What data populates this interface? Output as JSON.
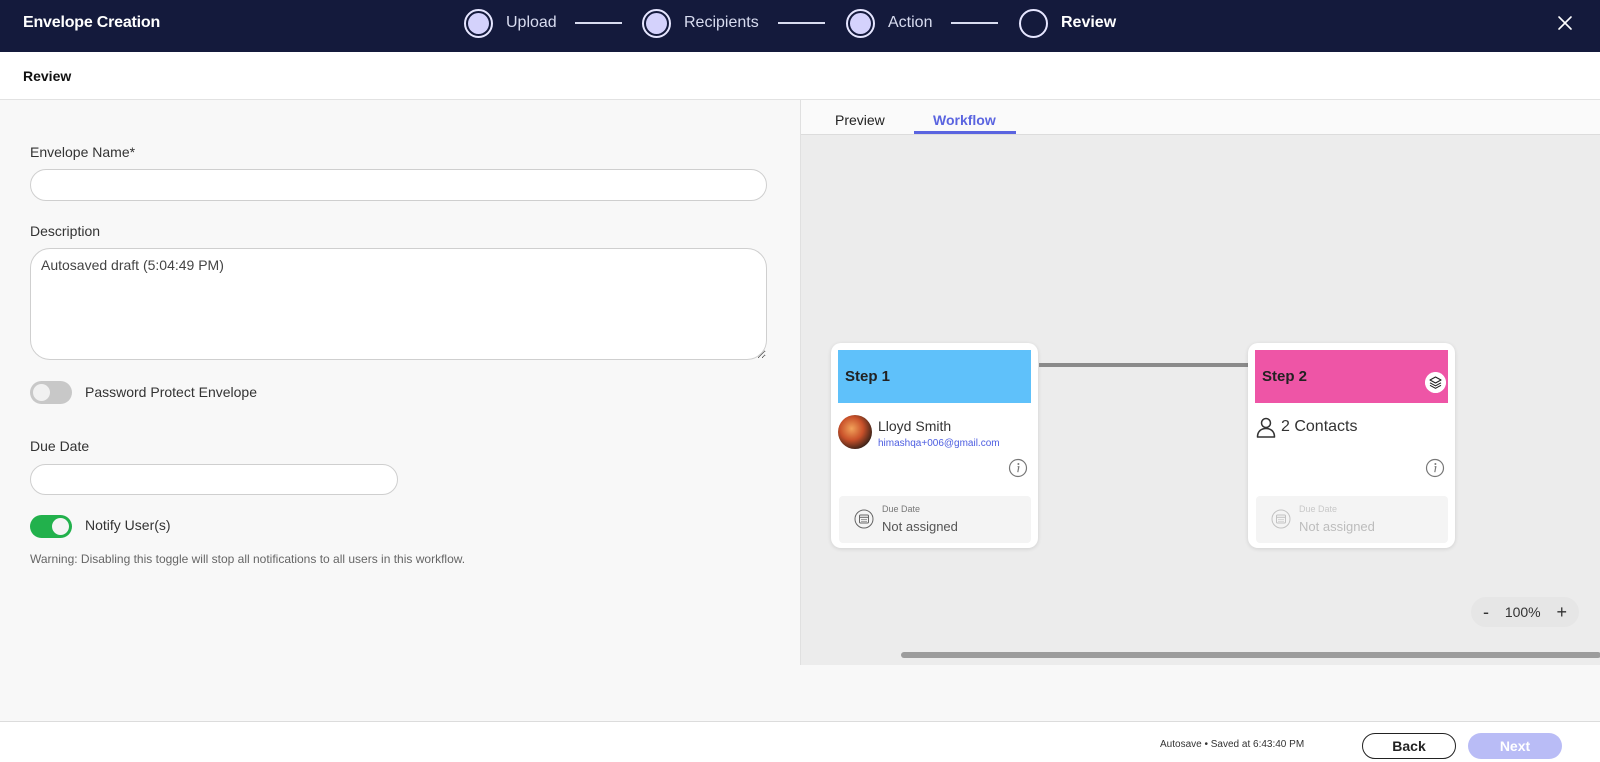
{
  "app": {
    "title": "Envelope Creation"
  },
  "stepper": {
    "steps": [
      {
        "label": "Upload",
        "state": "done"
      },
      {
        "label": "Recipients",
        "state": "done"
      },
      {
        "label": "Action",
        "state": "done"
      },
      {
        "label": "Review",
        "state": "current"
      }
    ]
  },
  "page": {
    "title": "Review"
  },
  "form": {
    "envelope_name_label": "Envelope Name*",
    "envelope_name_value": "",
    "description_label": "Description",
    "description_value": "Autosaved draft (5:04:49 PM)",
    "password_toggle_label": "Password Protect Envelope",
    "password_toggle_on": false,
    "due_date_label": "Due Date",
    "due_date_value": "",
    "notify_toggle_label": "Notify User(s)",
    "notify_toggle_on": true,
    "warning": "Warning: Disabling this toggle will stop all notifications to all users in this workflow."
  },
  "tabs": [
    {
      "label": "Preview",
      "active": false
    },
    {
      "label": "Workflow",
      "active": true
    }
  ],
  "workflow": {
    "steps": [
      {
        "title": "Step 1",
        "color": "#5fc1fa",
        "recipient_name": "Lloyd Smith",
        "recipient_email": "himashqa+006@gmail.com",
        "due_label": "Due Date",
        "due_value": "Not assigned"
      },
      {
        "title": "Step 2",
        "color": "#ee55a6",
        "contacts": "2 Contacts",
        "due_label": "Due Date",
        "due_value": "Not assigned"
      }
    ],
    "zoom": {
      "minus": "-",
      "value": "100%",
      "plus": "+"
    }
  },
  "footer": {
    "autosave": "Autosave • Saved at 6:43:40 PM",
    "back_label": "Back",
    "next_label": "Next"
  },
  "colors": {
    "topbar": "#141a3c",
    "accent": "#5a64e0",
    "toggle_on": "#22b14c",
    "next_disabled": "#b9bcf6"
  }
}
